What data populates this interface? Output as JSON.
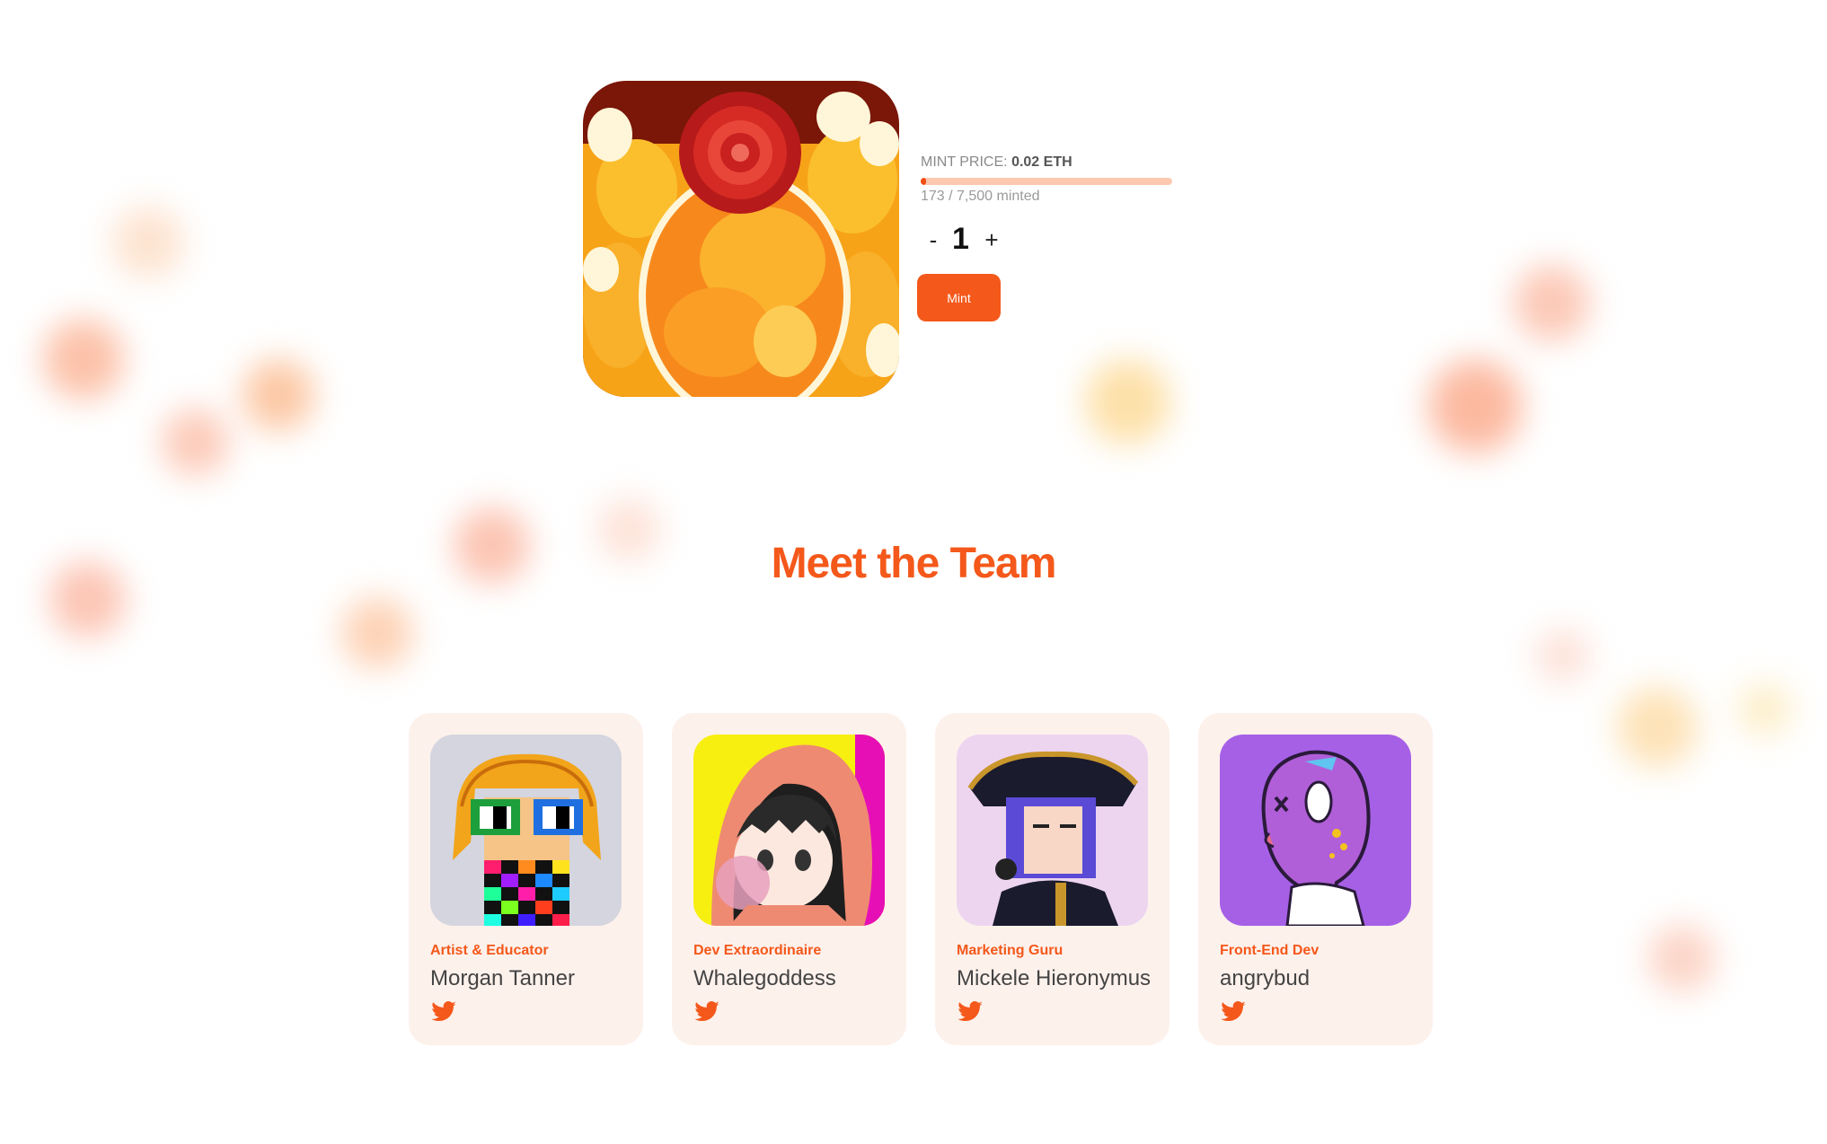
{
  "mint": {
    "price_label": "MINT PRICE:",
    "price_value": "0.02 ETH",
    "minted_text": "173 / 7,500 minted",
    "progress_fraction": 0.023,
    "decrement": "-",
    "quantity": "1",
    "increment": "+",
    "button_label": "Mint"
  },
  "team": {
    "title": "Meet the Team",
    "members": [
      {
        "role": "Artist & Educator",
        "name": "Morgan Tanner",
        "icon": "twitter-icon"
      },
      {
        "role": "Dev Extraordinaire",
        "name": "Whalegoddess",
        "icon": "twitter-icon"
      },
      {
        "role": "Marketing Guru",
        "name": "Mickele Hieronymus",
        "icon": "twitter-icon"
      },
      {
        "role": "Front-End Dev",
        "name": "angrybud",
        "icon": "twitter-icon"
      }
    ]
  },
  "colors": {
    "accent": "#f4581a",
    "card_bg": "#fdf1ec",
    "progress_track": "#fcc9b0"
  }
}
